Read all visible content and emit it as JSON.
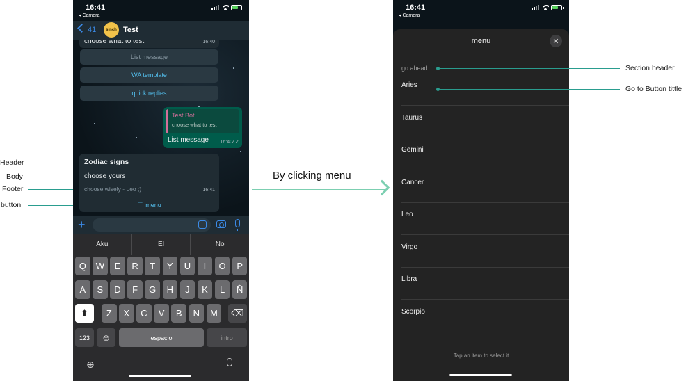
{
  "annotations": {
    "left": [
      "Header",
      "Body",
      "Footer",
      "button"
    ],
    "right": [
      "Section header",
      "Go to Button tittle"
    ],
    "middle": "By clicking menu"
  },
  "phone1": {
    "status": {
      "time": "16:41",
      "back_app": "◂ Camera"
    },
    "header": {
      "back_count": "41",
      "avatar_text": "sinch",
      "name": "Test"
    },
    "messages": {
      "first": {
        "text": "choose what to test",
        "time": "16:40"
      },
      "options": [
        "List message",
        "WA template",
        "quick replies"
      ],
      "outgoing": {
        "quote_title": "Test Bot",
        "quote_text": "choose what to test",
        "text": "List message",
        "time": "16:40"
      },
      "list": {
        "header": "Zodiac signs",
        "body": "choose yours",
        "footer": "choose wisely - Leo ;)",
        "time": "16:41",
        "button": "menu"
      }
    },
    "keyboard": {
      "suggestions": [
        "Aku",
        "El",
        "No"
      ],
      "row1": [
        "Q",
        "W",
        "E",
        "R",
        "T",
        "Y",
        "U",
        "I",
        "O",
        "P"
      ],
      "row2": [
        "A",
        "S",
        "D",
        "F",
        "G",
        "H",
        "J",
        "K",
        "L",
        "Ñ"
      ],
      "row3": [
        "Z",
        "X",
        "C",
        "V",
        "B",
        "N",
        "M"
      ],
      "num_key": "123",
      "space": "espacio",
      "enter": "intro"
    }
  },
  "phone2": {
    "status": {
      "time": "16:41",
      "back_app": "◂ Camera"
    },
    "sheet_title": "menu",
    "section_header": "go ahead",
    "items": [
      "Aries",
      "Taurus",
      "Gemini",
      "Cancer",
      "Leo",
      "Virgo",
      "Libra",
      "Scorpio"
    ],
    "hint": "Tap an item to select it"
  },
  "colors": {
    "accent_teal": "#2a9d8f",
    "wa_green": "#005c4b",
    "link_blue": "#53bdeb"
  }
}
